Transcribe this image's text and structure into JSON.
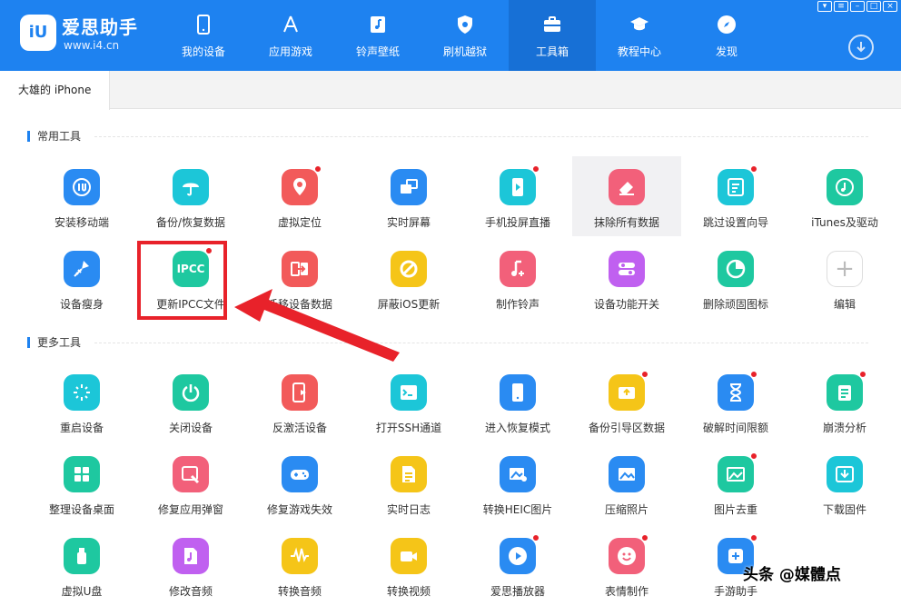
{
  "brand": {
    "logo_text": "iU",
    "name": "爱思助手",
    "url": "www.i4.cn"
  },
  "nav": [
    {
      "label": "我的设备",
      "icon": "phone-icon"
    },
    {
      "label": "应用游戏",
      "icon": "app-store-icon"
    },
    {
      "label": "铃声壁纸",
      "icon": "music-file-icon"
    },
    {
      "label": "刷机越狱",
      "icon": "shield-icon"
    },
    {
      "label": "工具箱",
      "icon": "toolbox-icon",
      "active": true
    },
    {
      "label": "教程中心",
      "icon": "graduation-cap-icon"
    },
    {
      "label": "发现",
      "icon": "compass-icon"
    }
  ],
  "device_tab": {
    "label": "大雄的 iPhone"
  },
  "sections": {
    "common": {
      "title": "常用工具"
    },
    "more": {
      "title": "更多工具"
    }
  },
  "common_tools": [
    {
      "label": "安装移动端",
      "icon": "iu-app-icon",
      "color": "#2a8bf2"
    },
    {
      "label": "备份/恢复数据",
      "icon": "umbrella-icon",
      "color": "#1cc6d8"
    },
    {
      "label": "虚拟定位",
      "icon": "location-pin-icon",
      "color": "#f25a5a",
      "badge": true
    },
    {
      "label": "实时屏幕",
      "icon": "screen-mirror-icon",
      "color": "#2a8bf2"
    },
    {
      "label": "手机投屏直播",
      "icon": "phone-play-icon",
      "color": "#1cc6d8",
      "badge": true
    },
    {
      "label": "抹除所有数据",
      "icon": "eraser-icon",
      "color": "#f2607a",
      "highlight": true
    },
    {
      "label": "跳过设置向导",
      "icon": "skip-guide-icon",
      "color": "#1cc6d8",
      "badge": true
    },
    {
      "label": "iTunes及驱动",
      "icon": "music-gear-icon",
      "color": "#1ec8a0"
    },
    {
      "label": "设备瘦身",
      "icon": "broom-icon",
      "color": "#2a8bf2"
    },
    {
      "label": "更新IPCC文件",
      "icon": "ipcc-icon",
      "icon_text": "IPCC",
      "color": "#1ec8a0",
      "badge": true
    },
    {
      "label": "迁移设备数据",
      "icon": "transfer-icon",
      "color": "#f25a5a"
    },
    {
      "label": "屏蔽iOS更新",
      "icon": "block-update-icon",
      "color": "#f5c518"
    },
    {
      "label": "制作铃声",
      "icon": "music-note-plus-icon",
      "color": "#f2607a"
    },
    {
      "label": "设备功能开关",
      "icon": "toggle-icon",
      "color": "#c060f0"
    },
    {
      "label": "删除顽固图标",
      "icon": "pie-clock-icon",
      "color": "#1ec8a0"
    },
    {
      "label": "编辑",
      "icon": "plus-icon",
      "icon_text": "+",
      "color": "#ffffff"
    }
  ],
  "more_tools": [
    {
      "label": "重启设备",
      "icon": "restart-icon",
      "color": "#1cc6d8"
    },
    {
      "label": "关闭设备",
      "icon": "power-icon",
      "color": "#1ec8a0"
    },
    {
      "label": "反激活设备",
      "icon": "deactivate-icon",
      "color": "#f25a5a"
    },
    {
      "label": "打开SSH通道",
      "icon": "terminal-icon",
      "color": "#1cc6d8"
    },
    {
      "label": "进入恢复模式",
      "icon": "recovery-phone-icon",
      "color": "#2a8bf2"
    },
    {
      "label": "备份引导区数据",
      "icon": "backup-drive-icon",
      "color": "#f5c518",
      "badge": true
    },
    {
      "label": "破解时间限额",
      "icon": "hourglass-icon",
      "color": "#2a8bf2",
      "badge": true
    },
    {
      "label": "崩溃分析",
      "icon": "clipboard-list-icon",
      "color": "#1ec8a0",
      "badge": true
    },
    {
      "label": "整理设备桌面",
      "icon": "grid-icon",
      "color": "#1ec8a0"
    },
    {
      "label": "修复应用弹窗",
      "icon": "repair-tool-icon",
      "color": "#f2607a"
    },
    {
      "label": "修复游戏失效",
      "icon": "gamepad-icon",
      "color": "#2a8bf2"
    },
    {
      "label": "实时日志",
      "icon": "log-file-icon",
      "color": "#f5c518"
    },
    {
      "label": "转换HEIC图片",
      "icon": "convert-image-icon",
      "color": "#2a8bf2"
    },
    {
      "label": "压缩照片",
      "icon": "image-icon",
      "color": "#2a8bf2"
    },
    {
      "label": "图片去重",
      "icon": "duplicate-image-icon",
      "color": "#1ec8a0",
      "badge": true
    },
    {
      "label": "下载固件",
      "icon": "download-box-icon",
      "color": "#1cc6d8"
    },
    {
      "label": "虚拟U盘",
      "icon": "usb-drive-icon",
      "color": "#1ec8a0"
    },
    {
      "label": "修改音频",
      "icon": "audio-file-icon",
      "color": "#c060f0"
    },
    {
      "label": "转换音频",
      "icon": "waveform-icon",
      "color": "#f5c518"
    },
    {
      "label": "转换视频",
      "icon": "video-icon",
      "color": "#f5c518"
    },
    {
      "label": "爱思播放器",
      "icon": "play-icon",
      "color": "#2a8bf2",
      "badge": true
    },
    {
      "label": "表情制作",
      "icon": "emoji-icon",
      "color": "#f2607a",
      "badge": true
    },
    {
      "label": "手游助手",
      "icon": "game-helper-icon",
      "color": "#2a8bf2",
      "badge": true
    }
  ],
  "watermark": {
    "text": "头条 @媒體点"
  }
}
